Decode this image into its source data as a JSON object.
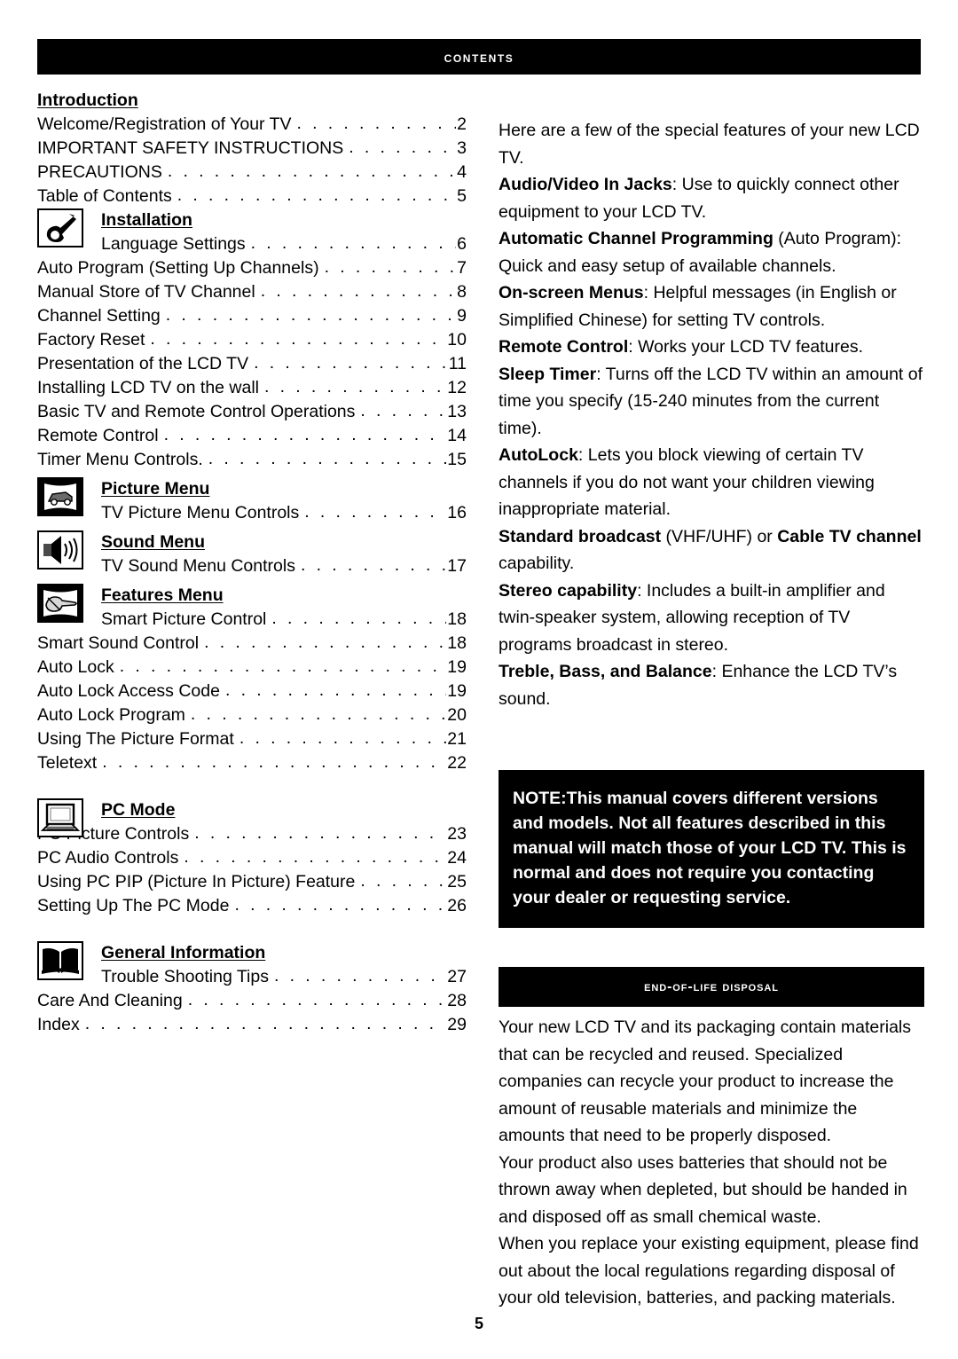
{
  "header": {
    "title": "Contents"
  },
  "toc": {
    "sections": [
      {
        "name": "Introduction",
        "icon": null,
        "entries": [
          {
            "title": "Welcome/Registration of Your TV",
            "page": "2",
            "indent": false
          },
          {
            "title": "IMPORTANT SAFETY INSTRUCTIONS",
            "page": "3",
            "indent": false
          },
          {
            "title": "PRECAUTIONS",
            "page": "4",
            "indent": false
          },
          {
            "title": "Table of Contents",
            "page": "5",
            "indent": false
          }
        ]
      },
      {
        "name": "Installation",
        "icon": "wrench-icon",
        "entries": [
          {
            "title": "Language Settings",
            "page": "6",
            "indent": true
          },
          {
            "title": "Auto Program (Setting Up Channels)",
            "page": "7",
            "indent": false
          },
          {
            "title": "Manual Store of TV Channel",
            "page": "8",
            "indent": false
          },
          {
            "title": "Channel Setting",
            "page": "9",
            "indent": false
          },
          {
            "title": "Factory Reset",
            "page": "10",
            "indent": false
          },
          {
            "title": "Presentation of the LCD TV",
            "page": "11",
            "indent": false
          },
          {
            "title": "Installing LCD TV on the wall",
            "page": "12",
            "indent": false
          },
          {
            "title": "Basic TV and Remote Control Operations",
            "page": "13",
            "indent": false
          },
          {
            "title": "Remote Control",
            "page": "14",
            "indent": false
          },
          {
            "title": "Timer Menu Controls.",
            "page": "15",
            "indent": false
          }
        ]
      },
      {
        "name": "Picture Menu",
        "icon": "picture-tv-icon",
        "entries": [
          {
            "title": "TV Picture Menu Controls",
            "page": "16",
            "indent": true
          }
        ]
      },
      {
        "name": "Sound Menu",
        "icon": "speaker-icon",
        "entries": [
          {
            "title": "TV Sound Menu Controls",
            "page": "17",
            "indent": true
          }
        ]
      },
      {
        "name": "Features Menu",
        "icon": "hand-pointer-icon",
        "entries": [
          {
            "title": "Smart Picture Control",
            "page": "18",
            "indent": true
          },
          {
            "title": "Smart Sound Control",
            "page": "18",
            "indent": false
          },
          {
            "title": "Auto Lock",
            "page": "19",
            "indent": false
          },
          {
            "title": "Auto Lock Access Code",
            "page": "19",
            "indent": false
          },
          {
            "title": "Auto Lock Program",
            "page": "20",
            "indent": false
          },
          {
            "title": "Using The Picture Format",
            "page": "21",
            "indent": false
          },
          {
            "title": "Teletext",
            "page": "22",
            "indent": false
          }
        ]
      },
      {
        "name": "PC Mode",
        "icon": "laptop-icon",
        "entries": [
          {
            "title": "PC Picture Controls",
            "page": "23",
            "indent": false
          },
          {
            "title": "PC Audio Controls",
            "page": "24",
            "indent": false
          },
          {
            "title": "Using PC PIP (Picture In Picture) Feature",
            "page": "25",
            "indent": false
          },
          {
            "title": "Setting Up The PC Mode",
            "page": "26",
            "indent": false
          }
        ]
      },
      {
        "name": "General Information",
        "icon": "open-book-icon",
        "entries": [
          {
            "title": "Trouble Shooting Tips",
            "page": "27",
            "indent": true
          },
          {
            "title": "Care And Cleaning",
            "page": "28",
            "indent": false
          },
          {
            "title": "Index",
            "page": "29",
            "indent": false
          }
        ]
      }
    ]
  },
  "features": {
    "intro": "Here are a few of the special features of your new LCD TV.",
    "items": [
      {
        "label": "Audio/Video In Jacks",
        "text": ": Use to quickly connect other equipment to your LCD TV."
      },
      {
        "label": "Automatic Channel Programming",
        "text": " (Auto Program): Quick and easy setup of available channels."
      },
      {
        "label": "On-screen Menus",
        "text": ": Helpful messages (in English or Simplified Chinese) for setting TV controls."
      },
      {
        "label": "Remote Control",
        "text": ": Works your LCD TV features."
      },
      {
        "label": "Sleep Timer",
        "text": ": Turns off the LCD TV within an amount of time you specify (15-240 minutes from the current time)."
      },
      {
        "label": "AutoLock",
        "text": ": Lets you block viewing of certain TV channels if you do not want your children viewing inappropriate material."
      },
      {
        "label": "Standard broadcast",
        "text": " (VHF/UHF) or ",
        "label2": "Cable TV channel",
        "text2": " capability."
      },
      {
        "label": "Stereo capability",
        "text": ": Includes a built-in amplifier and twin-speaker system, allowing reception of TV programs broadcast in stereo."
      },
      {
        "label": "Treble, Bass, and Balance",
        "text": ": Enhance the LCD TV’s sound."
      }
    ]
  },
  "note_box": {
    "text": "NOTE:This manual covers different versions and models. Not all features described in this manual will match those of your LCD TV. This is normal and does not require you contacting your dealer or requesting service."
  },
  "end_of_life": {
    "heading": "End-of-Life Disposal",
    "paragraphs": [
      "Your new LCD TV and its packaging contain materials that can be recycled and reused. Specialized companies can recycle your product to increase the amount of reusable materials and minimize the amounts that need to be properly disposed.",
      "Your product also uses batteries that should not be thrown away when depleted, but should be handed in and disposed off as small chemical waste.",
      "When you replace your existing equipment, please find out about the local regulations regarding disposal of your old television, batteries, and packing materials."
    ]
  },
  "footer": {
    "page_number": "5"
  },
  "colors": {
    "bar_background": "#000000",
    "bar_text": "#ffffff",
    "page_background": "#ffffff",
    "body_text": "#000000"
  }
}
